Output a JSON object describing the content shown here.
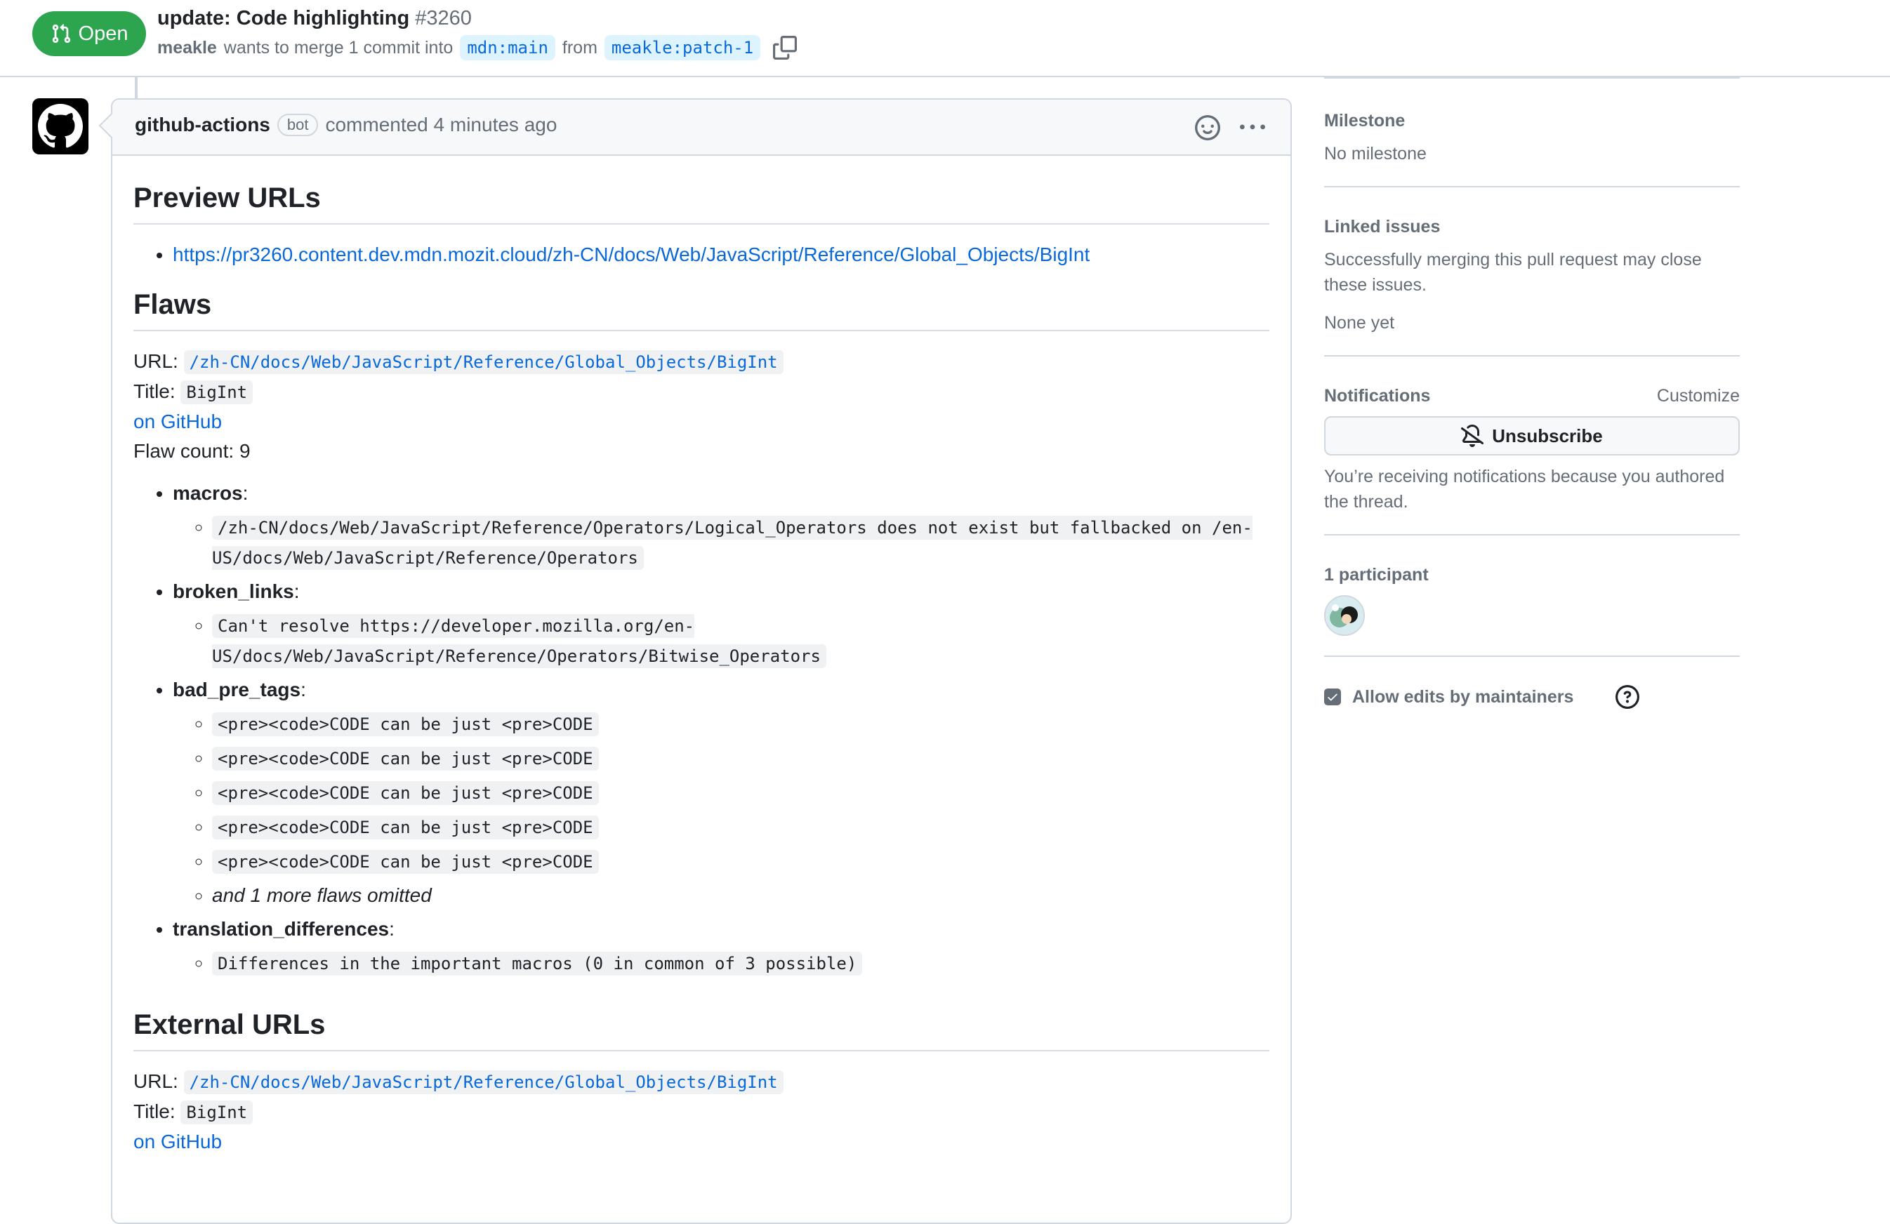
{
  "header": {
    "state": "Open",
    "title": "update: Code highlighting",
    "number": "#3260",
    "author": "meakle",
    "merge_text": "wants to merge 1 commit into",
    "base_branch": "mdn:main",
    "from_text": "from",
    "head_branch": "meakle:patch-1"
  },
  "comment": {
    "author": "github-actions",
    "badge": "bot",
    "action": "commented 4 minutes ago",
    "preview": {
      "heading": "Preview URLs",
      "url": "https://pr3260.content.dev.mdn.mozit.cloud/zh-CN/docs/Web/JavaScript/Reference/Global_Objects/BigInt"
    },
    "flaws": {
      "heading": "Flaws",
      "url_label": "URL:",
      "url": "/zh-CN/docs/Web/JavaScript/Reference/Global_Objects/BigInt",
      "title_label": "Title:",
      "title": "BigInt",
      "github_link": "on GitHub",
      "count_label": "Flaw count: 9",
      "items": [
        {
          "key": "macros",
          "entries": [
            "/zh-CN/docs/Web/JavaScript/Reference/Operators/Logical_Operators does not exist but fallbacked on /en-US/docs/Web/JavaScript/Reference/Operators"
          ]
        },
        {
          "key": "broken_links",
          "entries": [
            "Can't resolve https://developer.mozilla.org/en-US/docs/Web/JavaScript/Reference/Operators/Bitwise_Operators"
          ]
        },
        {
          "key": "bad_pre_tags",
          "entries": [
            "<pre><code>CODE can be just <pre>CODE",
            "<pre><code>CODE can be just <pre>CODE",
            "<pre><code>CODE can be just <pre>CODE",
            "<pre><code>CODE can be just <pre>CODE",
            "<pre><code>CODE can be just <pre>CODE"
          ],
          "omitted": "and 1 more flaws omitted"
        },
        {
          "key": "translation_differences",
          "entries": [
            "Differences in the important macros (0 in common of 3 possible)"
          ]
        }
      ]
    },
    "external": {
      "heading": "External URLs",
      "url_label": "URL:",
      "url": "/zh-CN/docs/Web/JavaScript/Reference/Global_Objects/BigInt",
      "title_label": "Title:",
      "title": "BigInt",
      "github_link": "on GitHub"
    }
  },
  "sidebar": {
    "milestone": {
      "heading": "Milestone",
      "value": "No milestone"
    },
    "linked_issues": {
      "heading": "Linked issues",
      "description": "Successfully merging this pull request may close these issues.",
      "value": "None yet"
    },
    "notifications": {
      "heading": "Notifications",
      "customize": "Customize",
      "button": "Unsubscribe",
      "reason": "You’re receiving notifications because you authored the thread."
    },
    "participants": {
      "heading": "1 participant"
    },
    "allow_edits": {
      "label": "Allow edits by maintainers",
      "checked": true
    }
  }
}
